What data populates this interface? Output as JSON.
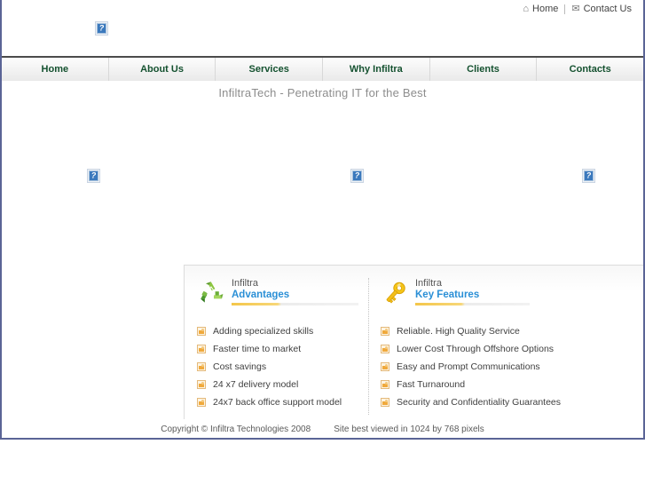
{
  "topbar": {
    "links": [
      {
        "label": "Home",
        "icon": "home-icon",
        "glyph": "⌂"
      },
      {
        "label": "Contact Us",
        "icon": "envelope-icon",
        "glyph": "✉"
      }
    ]
  },
  "logo": {
    "alt_icon": "broken-image-icon",
    "placeholder": "?"
  },
  "nav": {
    "items": [
      {
        "label": "Home",
        "name": "nav-home"
      },
      {
        "label": "About Us",
        "name": "nav-about-us"
      },
      {
        "label": "Services",
        "name": "nav-services"
      },
      {
        "label": "Why Infiltra",
        "name": "nav-why-infiltra"
      },
      {
        "label": "Clients",
        "name": "nav-clients"
      },
      {
        "label": "Contacts",
        "name": "nav-contacts"
      }
    ]
  },
  "tagline": "InfiltraTech - Penetrating IT for the Best",
  "banner_images": [
    {
      "name": "banner-image-left",
      "placeholder": "?"
    },
    {
      "name": "banner-image-center",
      "placeholder": "?"
    },
    {
      "name": "banner-image-right",
      "placeholder": "?"
    }
  ],
  "features": {
    "columns": [
      {
        "icon": "recycle-icon",
        "brand": "Infiltra",
        "title": "Advantages",
        "items": [
          "Adding specialized skills",
          "Faster time to market",
          "Cost savings",
          "24 x7 delivery model",
          "24x7 back office support model"
        ]
      },
      {
        "icon": "key-icon",
        "brand": "Infiltra",
        "title": "Key Features",
        "items": [
          "Reliable. High Quality Service",
          "Lower Cost Through Offshore Options",
          "Easy and Prompt Communications",
          "Fast Turnaround",
          "Security and Confidentiality Guarantees"
        ]
      }
    ]
  },
  "footer": {
    "copyright": "Copyright © Infiltra Technologies 2008",
    "resolution": "Site best viewed in 1024 by 768 pixels"
  },
  "colors": {
    "frame_border": "#5a6496",
    "nav_text": "#14512f",
    "feature_title": "#2a8fd6",
    "feature_rule": "#f4c64a",
    "tagline": "#8d8d8d"
  }
}
